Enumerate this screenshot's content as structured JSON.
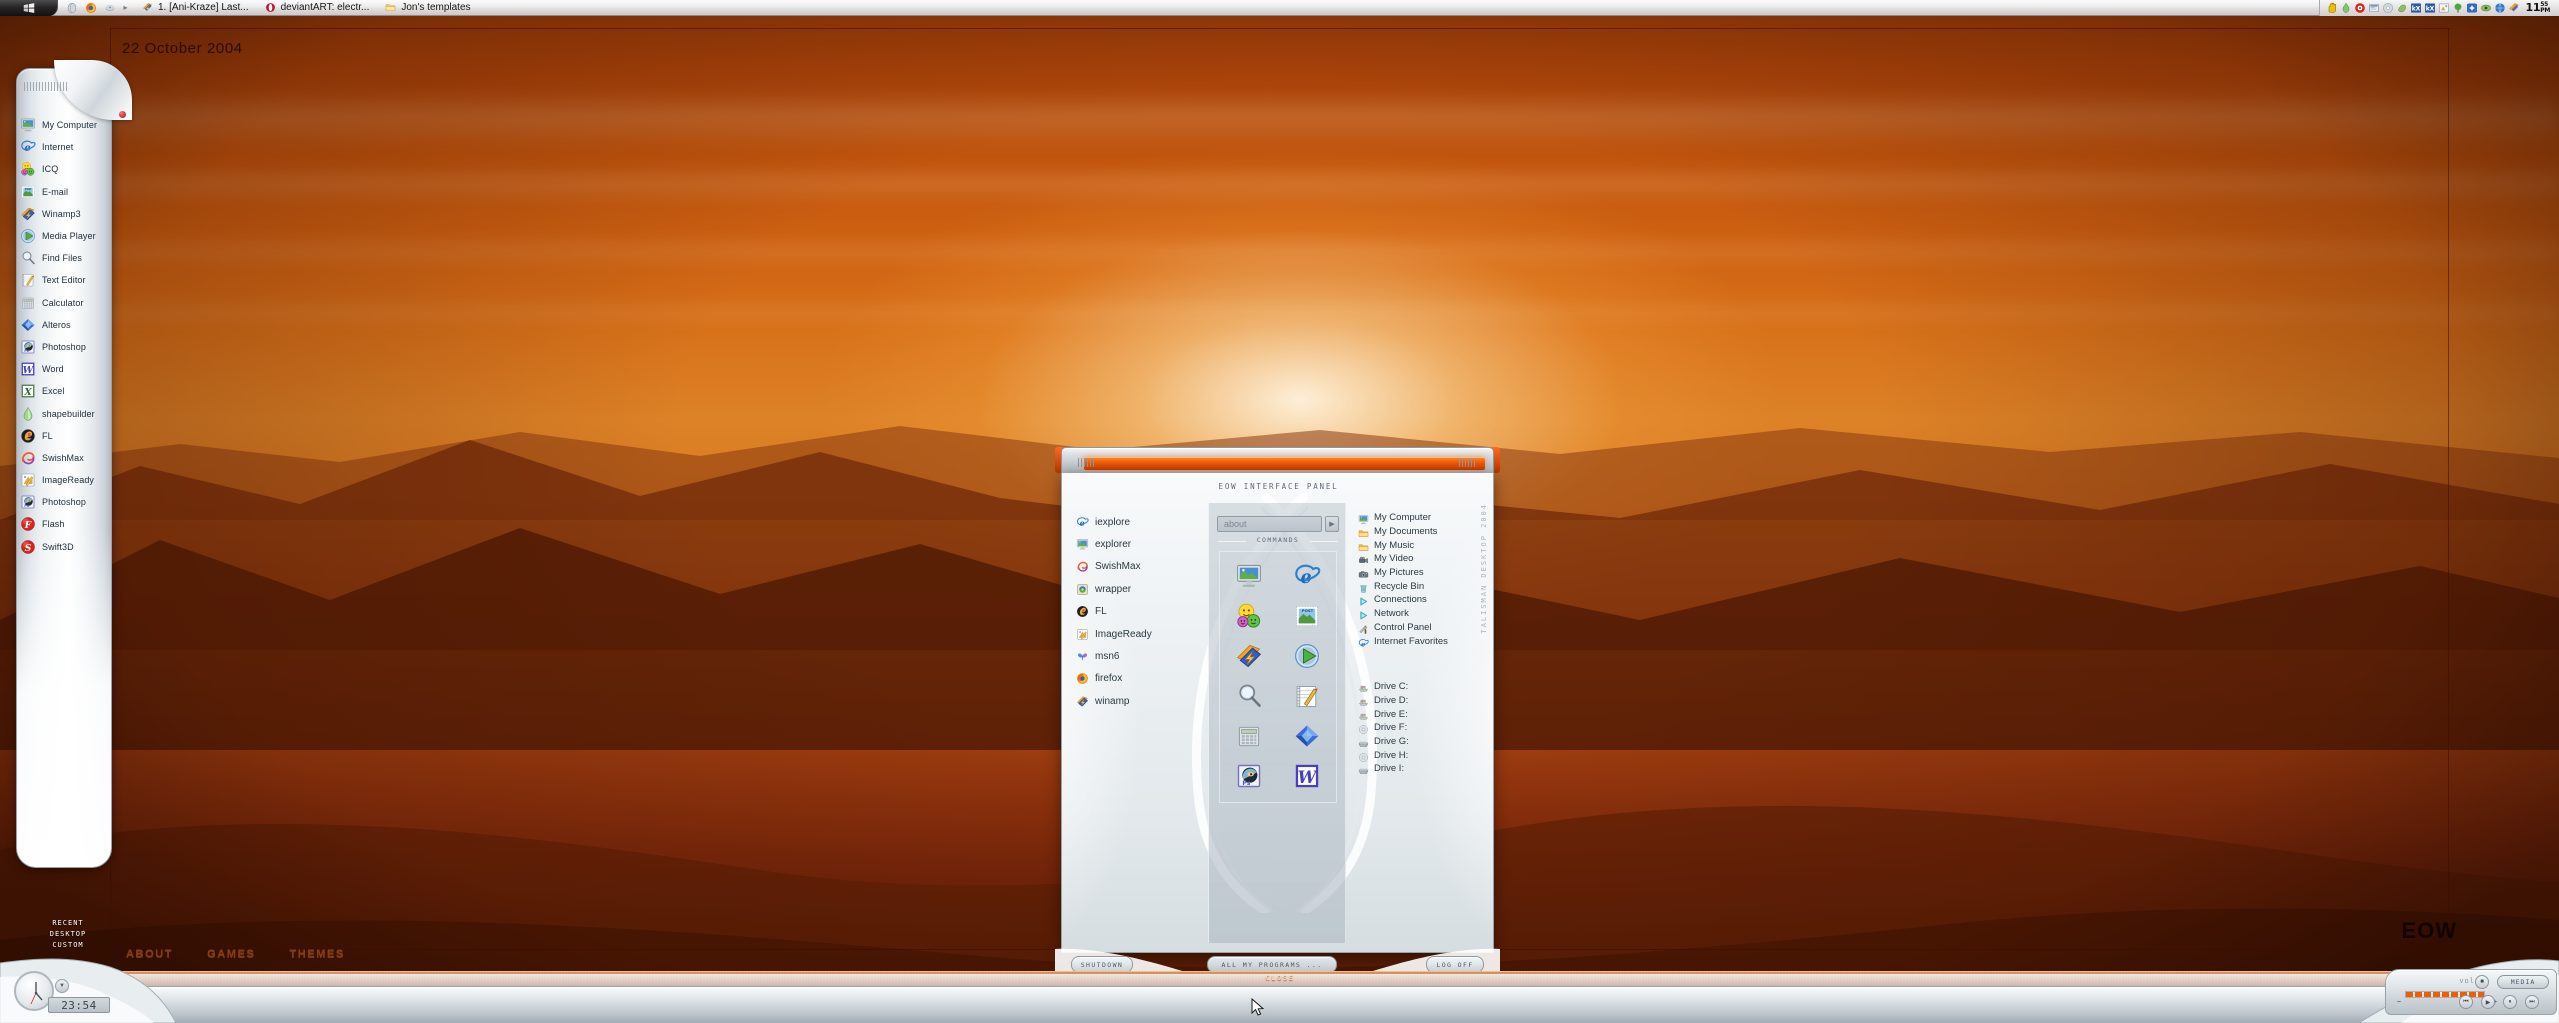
{
  "desktop": {
    "date_text": "22  October 2004",
    "nav_links": [
      "ABOUT",
      "GAMES",
      "THEMES"
    ],
    "logo": "EOW"
  },
  "topbar": {
    "start_icon": "windows-logo-icon",
    "quicklaunch": [
      {
        "name": "show-desktop-icon",
        "icon": "show-desktop-icon"
      },
      {
        "name": "firefox-icon",
        "icon": "firefox-icon"
      },
      {
        "name": "media-icon",
        "icon": "media-icon"
      }
    ],
    "separator": "▸",
    "tasks": [
      {
        "label": "1. [Ani-Kraze] Last...",
        "icon": "winamp-icon"
      },
      {
        "label": "deviantART: electr...",
        "icon": "opera-icon"
      },
      {
        "label": "Jon's templates",
        "icon": "folder-icon"
      }
    ],
    "tray_icons": [
      "hand-icon",
      "flame-icon",
      "daemon-tools-icon",
      "network-properties-icon",
      "disc-icon",
      "shell-icon",
      "kx-mixer-icon",
      "kx-mixer-2-icon",
      "imageready-icon",
      "tree-icon",
      "antivirus-icon",
      "eye-icon",
      "search-globe-icon",
      "winamp-tray-icon"
    ],
    "time": "11",
    "time_suffix": "55",
    "time_meridiem": "PM"
  },
  "dock": {
    "items": [
      {
        "label": "My Computer",
        "icon": "monitor-icon"
      },
      {
        "label": "Internet",
        "icon": "ie-icon"
      },
      {
        "label": "ICQ",
        "icon": "icq-smileys-icon"
      },
      {
        "label": "E-mail",
        "icon": "stamp-icon"
      },
      {
        "label": "Winamp3",
        "icon": "winamp-icon"
      },
      {
        "label": "Media Player",
        "icon": "media-player-icon"
      },
      {
        "label": "Find Files",
        "icon": "magnifier-icon"
      },
      {
        "label": "Text Editor",
        "icon": "notepad-icon"
      },
      {
        "label": "Calculator",
        "icon": "calculator-icon"
      },
      {
        "label": "Alteros",
        "icon": "alteros-diamond-icon"
      },
      {
        "label": "Photoshop",
        "icon": "photoshop-icon"
      },
      {
        "label": "Word",
        "icon": "word-icon"
      },
      {
        "label": "Excel",
        "icon": "excel-icon"
      },
      {
        "label": "shapebuilder",
        "icon": "shapebuilder-icon"
      },
      {
        "label": "FL",
        "icon": "fruityloops-icon"
      },
      {
        "label": "SwishMax",
        "icon": "swishmax-icon"
      },
      {
        "label": "ImageReady",
        "icon": "imageready-icon"
      },
      {
        "label": "Photoshop",
        "icon": "photoshop-icon"
      },
      {
        "label": "Flash",
        "icon": "flash-icon"
      },
      {
        "label": "Swift3D",
        "icon": "swift3d-icon"
      }
    ],
    "footer_lines": [
      "RECENT",
      "DESKTOP",
      "CUSTOM"
    ]
  },
  "panel": {
    "heading": "EOW INTERFACE PANEL",
    "vertical_brand": "TALISMAN DESKTOP 2004",
    "search": {
      "value": "about",
      "go_label": "▶"
    },
    "commands_label": "COMMANDS",
    "apps": [
      {
        "label": "iexplore",
        "icon": "ie-icon"
      },
      {
        "label": "explorer",
        "icon": "monitor-icon"
      },
      {
        "label": "SwishMax",
        "icon": "swishmax-icon"
      },
      {
        "label": "wrapper",
        "icon": "wrapper-icon"
      },
      {
        "label": "FL",
        "icon": "fruityloops-icon"
      },
      {
        "label": "ImageReady",
        "icon": "imageready-icon"
      },
      {
        "label": "msn6",
        "icon": "msn-butterfly-icon"
      },
      {
        "label": "firefox",
        "icon": "firefox-icon"
      },
      {
        "label": "winamp",
        "icon": "winamp-icon"
      }
    ],
    "grid_icons": [
      "monitor-icon",
      "ie-icon",
      "icq-smileys-icon",
      "stamp-icon",
      "winamp-icon",
      "media-player-icon",
      "magnifier-icon",
      "notepad-icon",
      "calculator-icon",
      "alteros-diamond-icon",
      "photoshop-icon",
      "word-icon"
    ],
    "places": [
      {
        "label": "My Computer",
        "icon": "monitor-icon"
      },
      {
        "label": "My Documents",
        "icon": "folder-icon"
      },
      {
        "label": "My Music",
        "icon": "folder-icon"
      },
      {
        "label": "My Video",
        "icon": "camcorder-icon"
      },
      {
        "label": "My Pictures",
        "icon": "camera-icon"
      },
      {
        "label": "Recycle Bin",
        "icon": "recycle-bin-icon"
      },
      {
        "label": "Connections",
        "icon": "play-arrow-icon"
      },
      {
        "label": "Network",
        "icon": "play-arrow-icon"
      },
      {
        "label": "Control Panel",
        "icon": "control-panel-icon"
      },
      {
        "label": "Internet Favorites",
        "icon": "ie-icon"
      }
    ],
    "drives": [
      {
        "label": "Drive C:",
        "icon": "hard-drive-icon"
      },
      {
        "label": "Drive D:",
        "icon": "hard-drive-icon"
      },
      {
        "label": "Drive E:",
        "icon": "hard-drive-icon"
      },
      {
        "label": "Drive F:",
        "icon": "cd-drive-icon"
      },
      {
        "label": "Drive G:",
        "icon": "removable-drive-icon"
      },
      {
        "label": "Drive H:",
        "icon": "cd-drive-icon"
      },
      {
        "label": "Drive I:",
        "icon": "removable-drive-icon"
      }
    ],
    "buttons": {
      "shutdown": "SHUTDOWN",
      "all_programs": "ALL MY PROGRAMS ...",
      "log_off": "LOG OFF"
    }
  },
  "bottombar": {
    "clock_digits": "23:54",
    "clock_dropdown": "▼",
    "close_label": "CLOSE",
    "media": {
      "label": "MEDIA",
      "vol_label": "vol",
      "minus": "−",
      "plus": "+",
      "buttons": [
        "■",
        "⏮",
        "▶",
        "⏸",
        "⏭"
      ]
    }
  },
  "colors": {
    "accent_orange": "#f15c06",
    "panel_silver": "#dde3e7",
    "text_dark": "#2b3942",
    "sky_top": "#8d3708"
  }
}
